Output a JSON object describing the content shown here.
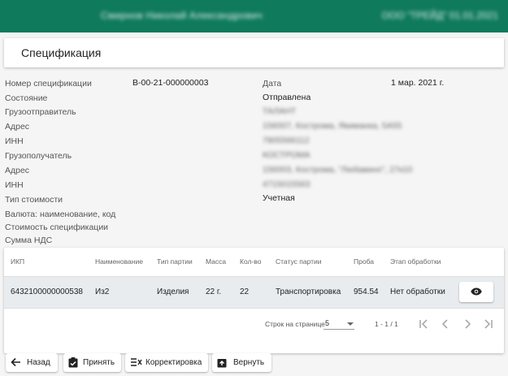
{
  "header": {
    "user_name": "Смирнов Николай Александрович",
    "user_info": "ООО \"ТРЕЙД\" 01.01.2021"
  },
  "title": "Спецификация",
  "fields_left": [
    {
      "label": "Номер спецификации",
      "value": "В-00-21-000000003"
    },
    {
      "label": "Состояние",
      "value": "Отправлена"
    },
    {
      "label": "Грузоотправитель",
      "value": "ТАЛАНТ"
    },
    {
      "label": "Адрес",
      "value": "156007, Кострома, Якиманка, 5А55"
    },
    {
      "label": "ИНН",
      "value": "7805566112"
    },
    {
      "label": "Грузополучатель",
      "value": "КОСТРОМА"
    },
    {
      "label": "Адрес",
      "value": "156003, Кострома, \"Любавино\", 27к10"
    },
    {
      "label": "ИНН",
      "value": "4715015563"
    },
    {
      "label": "Тип стоимости",
      "value": "Учетная"
    },
    {
      "label": "Валюта: наименование, код",
      "value": ""
    },
    {
      "label": "Стоимость спецификации",
      "value": ""
    },
    {
      "label": "Сумма НДС",
      "value": ""
    }
  ],
  "date": {
    "label": "Дата",
    "value": "1 мар. 2021 г."
  },
  "table": {
    "columns": [
      "ИКП",
      "Наименование",
      "Тип партии",
      "Масса",
      "Кол-во",
      "Статус партии",
      "Проба",
      "Этап обработки"
    ],
    "rows": [
      [
        "6432100000000538",
        "Из2",
        "Изделия",
        "22 г.",
        "22",
        "Транспортировка",
        "954.54",
        "Нет обработки"
      ]
    ]
  },
  "pagination": {
    "rows_label": "Строк на странице",
    "rows_value": "5",
    "range": "1 - 1 / 1"
  },
  "actions": {
    "back": "Назад",
    "accept": "Принять",
    "correct": "Корректировка",
    "return": "Вернуть"
  }
}
